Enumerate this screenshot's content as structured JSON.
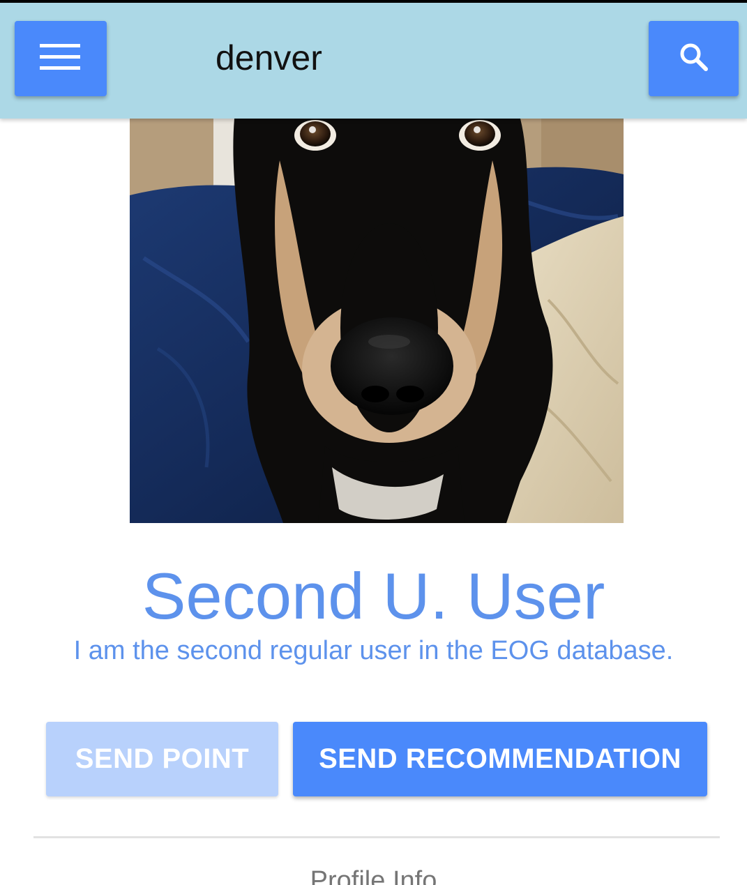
{
  "app_bar": {
    "title": "denver",
    "menu_icon": "hamburger-menu-icon",
    "search_icon": "search-icon",
    "background": "#acd8e6",
    "button_color": "#4a89fb"
  },
  "profile": {
    "photo_subject": "dog-photo",
    "name": "Second U. User",
    "bio": "I am the second regular user in the EOG database.",
    "accent_color": "#5d92ec"
  },
  "actions": {
    "send_point_label": "SEND POINT",
    "send_point_color": "#b8d1fc",
    "send_recommendation_label": "SEND RECOMMENDATION",
    "send_recommendation_color": "#4a89fb"
  },
  "sections": {
    "profile_info_heading": "Profile Info"
  }
}
